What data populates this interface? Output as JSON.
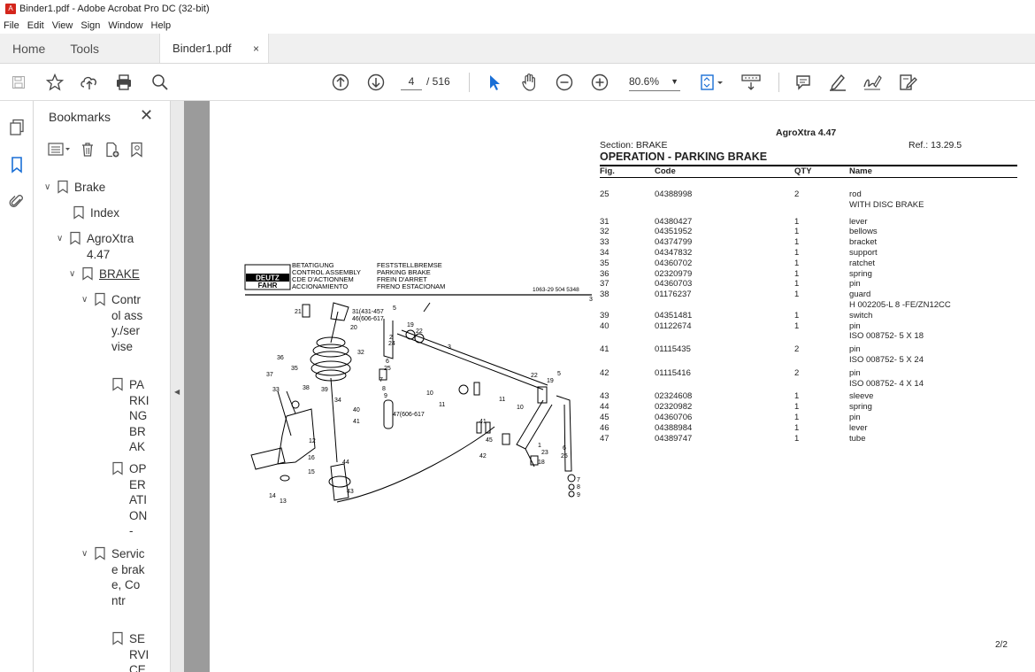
{
  "window": {
    "title": "Binder1.pdf - Adobe Acrobat Pro DC (32-bit)"
  },
  "menu": [
    "File",
    "Edit",
    "View",
    "Sign",
    "Window",
    "Help"
  ],
  "tabs": {
    "home": "Home",
    "tools": "Tools",
    "document": "Binder1.pdf",
    "close": "×"
  },
  "toolbar": {
    "page_current": "4",
    "page_total": "/ 516",
    "zoom": "80.6%"
  },
  "bookmarks": {
    "title": "Bookmarks",
    "close": "✕",
    "items": [
      {
        "label": "Brake",
        "chevron": "∨"
      },
      {
        "label": "Index",
        "chevron": ""
      },
      {
        "label": "AgroXtra 4.47",
        "chevron": "∨"
      },
      {
        "label": "BRAKE",
        "chevron": "∨"
      },
      {
        "label": "Control assy./servise",
        "chevron": "∨"
      },
      {
        "label": "PARKING BRAK",
        "chevron": ""
      },
      {
        "label": "OPERATION -",
        "chevron": ""
      },
      {
        "label": "Service brake, Contr",
        "chevron": "∨"
      },
      {
        "label": "SERVICE",
        "chevron": ""
      }
    ]
  },
  "document": {
    "model": "AgroXtra 4.47",
    "section": "Section: BRAKE",
    "ref": "Ref.: 13.29.5",
    "heading": "OPERATION - PARKING BRAKE",
    "columns": {
      "fig": "Fig.",
      "code": "Code",
      "qty": "QTY",
      "name": "Name"
    },
    "rows": [
      {
        "fig": "25",
        "code": "04388998",
        "qty": "2",
        "name": "rod",
        "note": "WITH DISC BRAKE"
      },
      {
        "fig": "31",
        "code": "04380427",
        "qty": "1",
        "name": "lever",
        "note": ""
      },
      {
        "fig": "32",
        "code": "04351952",
        "qty": "1",
        "name": "bellows",
        "note": ""
      },
      {
        "fig": "33",
        "code": "04374799",
        "qty": "1",
        "name": "bracket",
        "note": ""
      },
      {
        "fig": "34",
        "code": "04347832",
        "qty": "1",
        "name": "support",
        "note": ""
      },
      {
        "fig": "35",
        "code": "04360702",
        "qty": "1",
        "name": "ratchet",
        "note": ""
      },
      {
        "fig": "36",
        "code": "02320979",
        "qty": "1",
        "name": "spring",
        "note": ""
      },
      {
        "fig": "37",
        "code": "04360703",
        "qty": "1",
        "name": "pin",
        "note": ""
      },
      {
        "fig": "38",
        "code": "01176237",
        "qty": "1",
        "name": "guard",
        "note": "H 002205-L 8 -FE/ZN12CC"
      },
      {
        "fig": "39",
        "code": "04351481",
        "qty": "1",
        "name": "switch",
        "note": ""
      },
      {
        "fig": "40",
        "code": "01122674",
        "qty": "1",
        "name": "pin",
        "note": "ISO 008752- 5 X 18"
      },
      {
        "fig": "41",
        "code": "01115435",
        "qty": "2",
        "name": "pin",
        "note": "ISO 008752- 5 X 24"
      },
      {
        "fig": "42",
        "code": "01115416",
        "qty": "2",
        "name": "pin",
        "note": "ISO 008752- 4 X 14"
      },
      {
        "fig": "43",
        "code": "02324608",
        "qty": "1",
        "name": "sleeve",
        "note": ""
      },
      {
        "fig": "44",
        "code": "02320982",
        "qty": "1",
        "name": "spring",
        "note": ""
      },
      {
        "fig": "45",
        "code": "04360706",
        "qty": "1",
        "name": "pin",
        "note": ""
      },
      {
        "fig": "46",
        "code": "04388984",
        "qty": "1",
        "name": "lever",
        "note": ""
      },
      {
        "fig": "47",
        "code": "04389747",
        "qty": "1",
        "name": "tube",
        "note": ""
      }
    ],
    "page_label": "2/2",
    "diagram": {
      "logo": "DEUTZ FAHR",
      "captions_left": [
        "BETATIGUNG",
        "CONTROL ASSEMBLY",
        "CDE D'ACTIONNEM",
        "ACCIONAMIENTO"
      ],
      "captions_right": [
        "FESTSTELLBREMSE",
        "PARKING BRAKE",
        "FREIN D'ARRET",
        "FRENO ESTACIONAM"
      ],
      "drawing_no": "1063-29 504 5348",
      "sheet": "3"
    }
  }
}
